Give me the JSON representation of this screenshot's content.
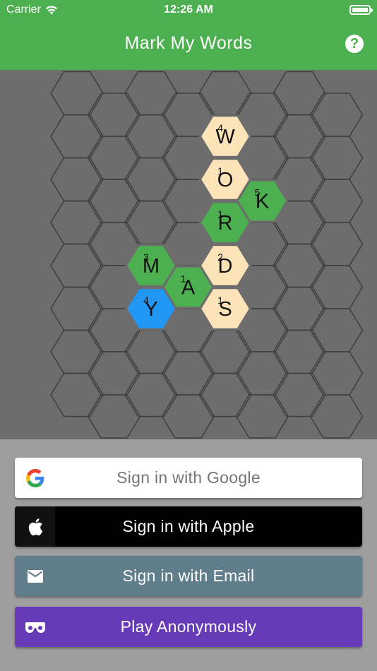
{
  "status_bar": {
    "carrier": "Carrier",
    "time": "12:26 AM",
    "wifi_icon": "wifi-icon",
    "battery_icon": "battery-icon"
  },
  "app_bar": {
    "title": "Mark My Words",
    "help_icon": "help-icon",
    "help_glyph": "?",
    "color": "#4caf50"
  },
  "board": {
    "background": "#6d6d6d",
    "grid_columns": 8,
    "grid_rows": 8,
    "tile_colors": {
      "played": "#fde3b8",
      "selected": "#4caf50",
      "current": "#2196f3"
    },
    "tiles": [
      {
        "letter": "W",
        "score": "4",
        "col": 4,
        "row": 1,
        "state": "played"
      },
      {
        "letter": "O",
        "score": "1",
        "col": 4,
        "row": 2,
        "state": "played"
      },
      {
        "letter": "K",
        "score": "5",
        "col": 5,
        "row": 2,
        "state": "selected"
      },
      {
        "letter": "R",
        "score": "1",
        "col": 4,
        "row": 3,
        "state": "selected"
      },
      {
        "letter": "A",
        "score": "1",
        "col": 3,
        "row": 4,
        "state": "selected"
      },
      {
        "letter": "D",
        "score": "2",
        "col": 4,
        "row": 4,
        "state": "played"
      },
      {
        "letter": "M",
        "score": "3",
        "col": 2,
        "row": 4,
        "state": "selected"
      },
      {
        "letter": "Y",
        "score": "4",
        "col": 2,
        "row": 5,
        "state": "current"
      },
      {
        "letter": "S",
        "score": "1",
        "col": 4,
        "row": 5,
        "state": "played"
      }
    ]
  },
  "signin": {
    "google_label": "Sign in with Google",
    "apple_label": "Sign in with Apple",
    "email_label": "Sign in with Email",
    "anonymous_label": "Play Anonymously",
    "google_icon": "google-g-icon",
    "apple_icon": "apple-logo-icon",
    "email_icon": "envelope-icon",
    "anonymous_icon": "mask-icon",
    "colors": {
      "google": "#ffffff",
      "apple": "#000000",
      "email": "#607d8b",
      "anonymous": "#673ab7"
    }
  }
}
